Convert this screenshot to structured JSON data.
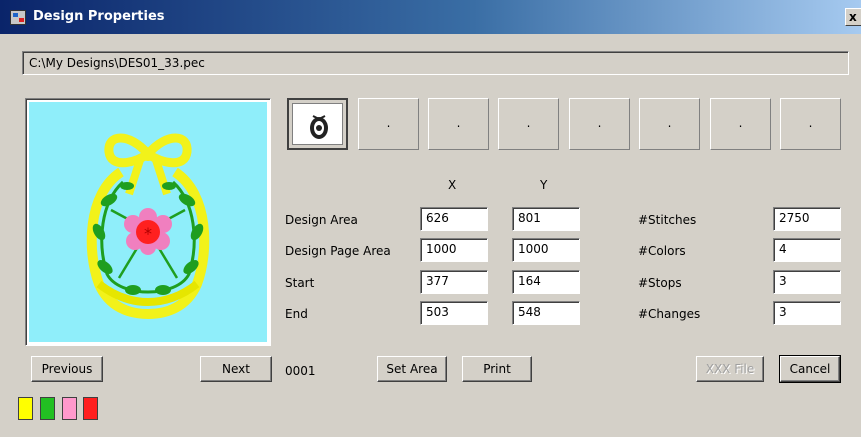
{
  "window": {
    "title": "Design Properties",
    "close_glyph": "x"
  },
  "file_path": "C:\\My Designs\\DES01_33.pec",
  "thumbnails": [
    {
      "selected": true,
      "label": ""
    },
    {
      "selected": false,
      "label": "."
    },
    {
      "selected": false,
      "label": "."
    },
    {
      "selected": false,
      "label": "."
    },
    {
      "selected": false,
      "label": "."
    },
    {
      "selected": false,
      "label": "."
    },
    {
      "selected": false,
      "label": "."
    },
    {
      "selected": false,
      "label": "."
    }
  ],
  "columns": {
    "x": "X",
    "y": "Y"
  },
  "rows": [
    {
      "label": "Design Area",
      "x": "626",
      "y": "801"
    },
    {
      "label": "Design Page Area",
      "x": "1000",
      "y": "1000"
    },
    {
      "label": "Start",
      "x": "377",
      "y": "164"
    },
    {
      "label": "End",
      "x": "503",
      "y": "548"
    }
  ],
  "stats": [
    {
      "label": "#Stitches",
      "value": "2750"
    },
    {
      "label": "#Colors",
      "value": "4"
    },
    {
      "label": "#Stops",
      "value": "3"
    },
    {
      "label": "#Changes",
      "value": "3"
    }
  ],
  "page_number": "0001",
  "buttons": {
    "previous": "Previous",
    "next": "Next",
    "set_area": "Set Area",
    "print": "Print",
    "xxx_file": "XXX File",
    "cancel": "Cancel"
  },
  "color_swatches": [
    "#ffff00",
    "#22c022",
    "#ff99cc",
    "#ff1f1f"
  ],
  "colors": {
    "preview_bg": "#8feefa",
    "title_start": "#0a246a",
    "title_end": "#a6caf0"
  }
}
